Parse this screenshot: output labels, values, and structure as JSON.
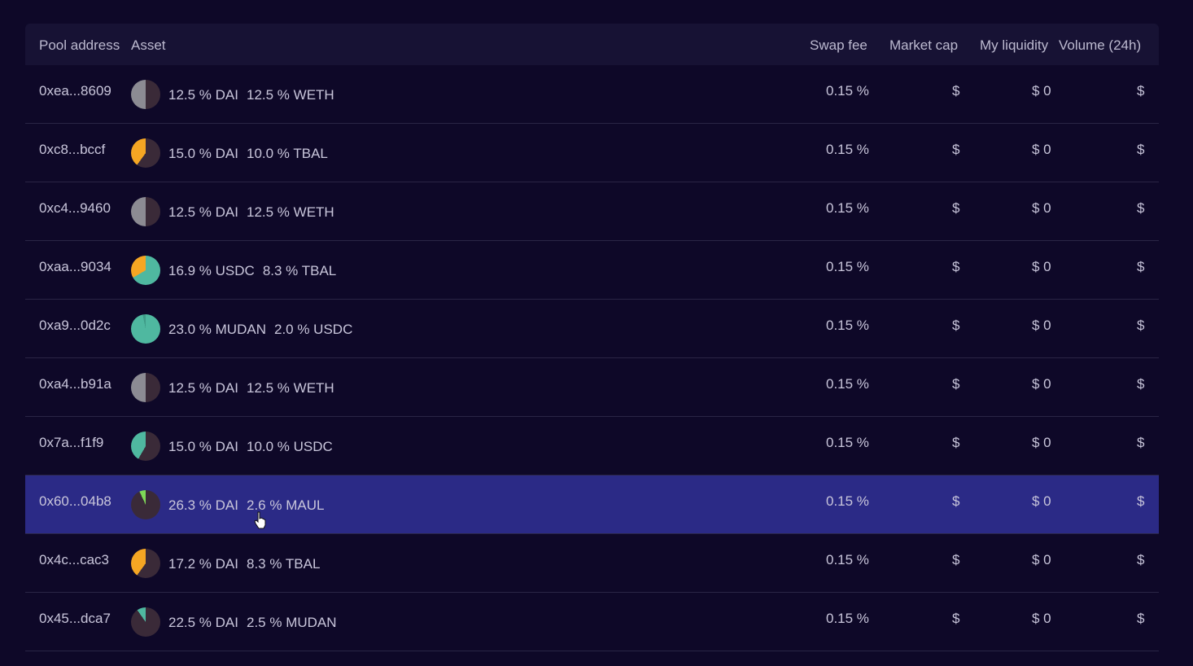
{
  "header": {
    "pool_address": "Pool address",
    "asset": "Asset",
    "swap_fee": "Swap fee",
    "market_cap": "Market cap",
    "my_liquidity": "My liquidity",
    "volume": "Volume (24h)"
  },
  "colors": {
    "background": "#0e0828",
    "header_bg": "#171234",
    "selected_row": "#2b2a86",
    "pie_base": "#3a2a38",
    "dai_gray": "#8c8b93",
    "tbal_orange": "#f5a623",
    "usdc_teal": "#4fb8a0",
    "maul_green": "#7ed957"
  },
  "rows": [
    {
      "address": "0xea...8609",
      "asset1": "12.5 % DAI",
      "asset2": "12.5 % WETH",
      "fee": "0.15 %",
      "mcap": "$",
      "liq": "$ 0",
      "vol": "$",
      "pie": "weth"
    },
    {
      "address": "0xc8...bccf",
      "asset1": "15.0 % DAI",
      "asset2": "10.0 % TBAL",
      "fee": "0.15 %",
      "mcap": "$",
      "liq": "$ 0",
      "vol": "$",
      "pie": "tbal"
    },
    {
      "address": "0xc4...9460",
      "asset1": "12.5 % DAI",
      "asset2": "12.5 % WETH",
      "fee": "0.15 %",
      "mcap": "$",
      "liq": "$ 0",
      "vol": "$",
      "pie": "weth"
    },
    {
      "address": "0xaa...9034",
      "asset1": "16.9 % USDC",
      "asset2": "8.3 % TBAL",
      "fee": "0.15 %",
      "mcap": "$",
      "liq": "$ 0",
      "vol": "$",
      "pie": "usdc-tbal"
    },
    {
      "address": "0xa9...0d2c",
      "asset1": "23.0 % MUDAN",
      "asset2": "2.0 % USDC",
      "fee": "0.15 %",
      "mcap": "$",
      "liq": "$ 0",
      "vol": "$",
      "pie": "mudan"
    },
    {
      "address": "0xa4...b91a",
      "asset1": "12.5 % DAI",
      "asset2": "12.5 % WETH",
      "fee": "0.15 %",
      "mcap": "$",
      "liq": "$ 0",
      "vol": "$",
      "pie": "weth"
    },
    {
      "address": "0x7a...f1f9",
      "asset1": "15.0 % DAI",
      "asset2": "10.0 % USDC",
      "fee": "0.15 %",
      "mcap": "$",
      "liq": "$ 0",
      "vol": "$",
      "pie": "usdc"
    },
    {
      "address": "0x60...04b8",
      "asset1": "26.3 % DAI",
      "asset2": "2.6 % MAUL",
      "fee": "0.15 %",
      "mcap": "$",
      "liq": "$ 0",
      "vol": "$",
      "pie": "maul",
      "selected": true
    },
    {
      "address": "0x4c...cac3",
      "asset1": "17.2 % DAI",
      "asset2": "8.3 % TBAL",
      "fee": "0.15 %",
      "mcap": "$",
      "liq": "$ 0",
      "vol": "$",
      "pie": "tbal"
    },
    {
      "address": "0x45...dca7",
      "asset1": "22.5 % DAI",
      "asset2": "2.5 % MUDAN",
      "fee": "0.15 %",
      "mcap": "$",
      "liq": "$ 0",
      "vol": "$",
      "pie": "mudan-small"
    }
  ]
}
